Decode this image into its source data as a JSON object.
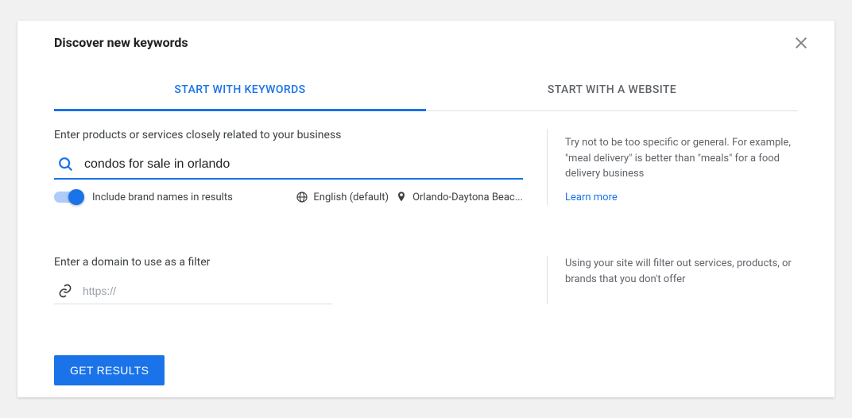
{
  "header": {
    "title": "Discover new keywords"
  },
  "tabs": {
    "keywords": "START WITH KEYWORDS",
    "website": "START WITH A WEBSITE"
  },
  "keywords": {
    "label": "Enter products or services closely related to your business",
    "value": "condos for sale in orlando",
    "toggle_label": "Include brand names in results",
    "language": "English (default)",
    "location": "Orlando-Daytona Beac...",
    "help_text": "Try not to be too specific or general. For example, \"meal delivery\" is better than \"meals\" for a food delivery business",
    "learn_more": "Learn more"
  },
  "domain": {
    "label": "Enter a domain to use as a filter",
    "placeholder": "https://",
    "help_text": "Using your site will filter out services, products, or brands that you don't offer"
  },
  "submit": {
    "label": "GET RESULTS"
  }
}
